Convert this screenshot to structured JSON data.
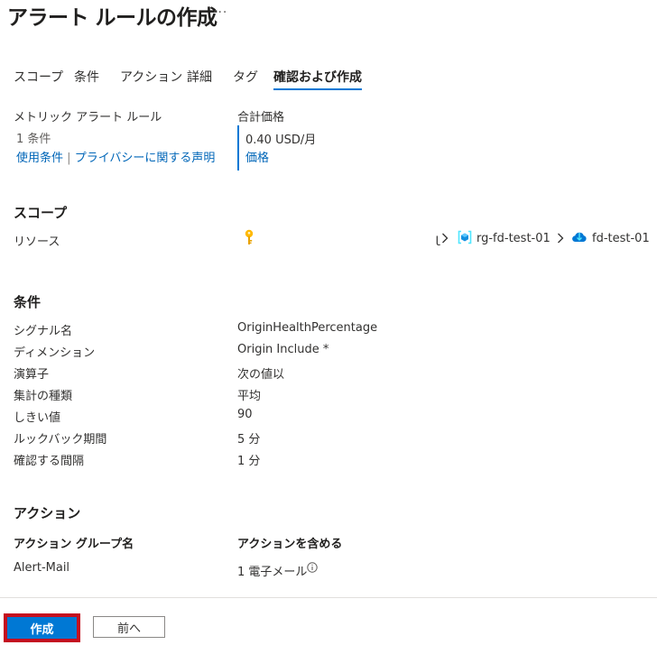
{
  "header": {
    "title": "アラート ルールの作成",
    "more": "···"
  },
  "tabs": [
    {
      "label": "スコープ"
    },
    {
      "label": "条件"
    },
    {
      "label": "アクション"
    },
    {
      "label": "詳細"
    },
    {
      "label": "タグ"
    },
    {
      "label": "確認および作成",
      "active": true
    }
  ],
  "summary": {
    "rule_type": "メトリック アラート ルール",
    "condition_count": "1 条件",
    "terms_link": "使用条件",
    "separator": "|",
    "privacy_link": "プライバシーに関する声明",
    "total_price_label": "合計価格",
    "total_price": "0.40 USD/月",
    "pricing_link": "価格"
  },
  "scope": {
    "title": "スコープ",
    "resource_label": "リソース",
    "path_truncated": "ｌ",
    "resource_group": "rg-fd-test-01",
    "resource": "fd-test-01"
  },
  "condition": {
    "title": "条件",
    "rows": [
      {
        "label": "シグナル名",
        "value": "OriginHealthPercentage"
      },
      {
        "label": "ディメンション",
        "value": "Origin Include *"
      },
      {
        "label": "演算子",
        "value": "次の値以"
      },
      {
        "label": "集計の種類",
        "value": "平均"
      },
      {
        "label": "しきい値",
        "value": "90"
      },
      {
        "label": "ルックバック期間",
        "value": "5 分"
      },
      {
        "label": "確認する間隔",
        "value": "1 分"
      }
    ]
  },
  "actions": {
    "title": "アクション",
    "col_group_name": "アクション グループ名",
    "col_includes": "アクションを含める",
    "group_name": "Alert-Mail",
    "includes": "1 電子メール"
  },
  "footer": {
    "create_label": "作成",
    "prev_label": "前へ"
  },
  "colors": {
    "accent": "#0078d4",
    "highlight": "#c50f1f",
    "key": "#ffb900"
  }
}
